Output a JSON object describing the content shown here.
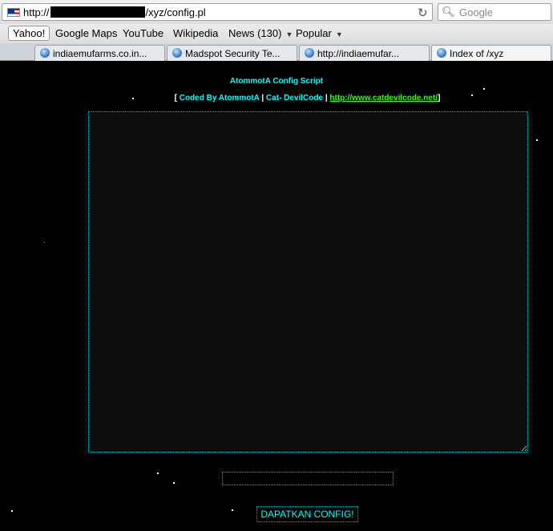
{
  "browser": {
    "url_prefix": "http://",
    "url_suffix": "/xyz/config.pl",
    "search_placeholder": "Google",
    "bookmarks": [
      "Yahoo!",
      "Google Maps",
      "YouTube",
      "Wikipedia",
      "News (130)",
      "Popular"
    ],
    "tabs": [
      "indiaemufarms.co.in...",
      "Madspot Security Te...",
      "http://indiaemufar...",
      "Index of /xyz"
    ]
  },
  "page": {
    "title": "AtommotA Config Script",
    "credits": {
      "open": "[",
      "coded_by": "Coded By AtommotA",
      "sep1": "|",
      "cat": "Cat- DevilCode",
      "sep2": "|",
      "link": "http://www.catdevilcode.net/",
      "close": "]"
    },
    "textarea_value": "",
    "input_value": "",
    "button_label": "DAPATKAN CONFIG!"
  },
  "colors": {
    "accent": "#00ffff",
    "link": "#33ff00",
    "background": "#000000"
  }
}
